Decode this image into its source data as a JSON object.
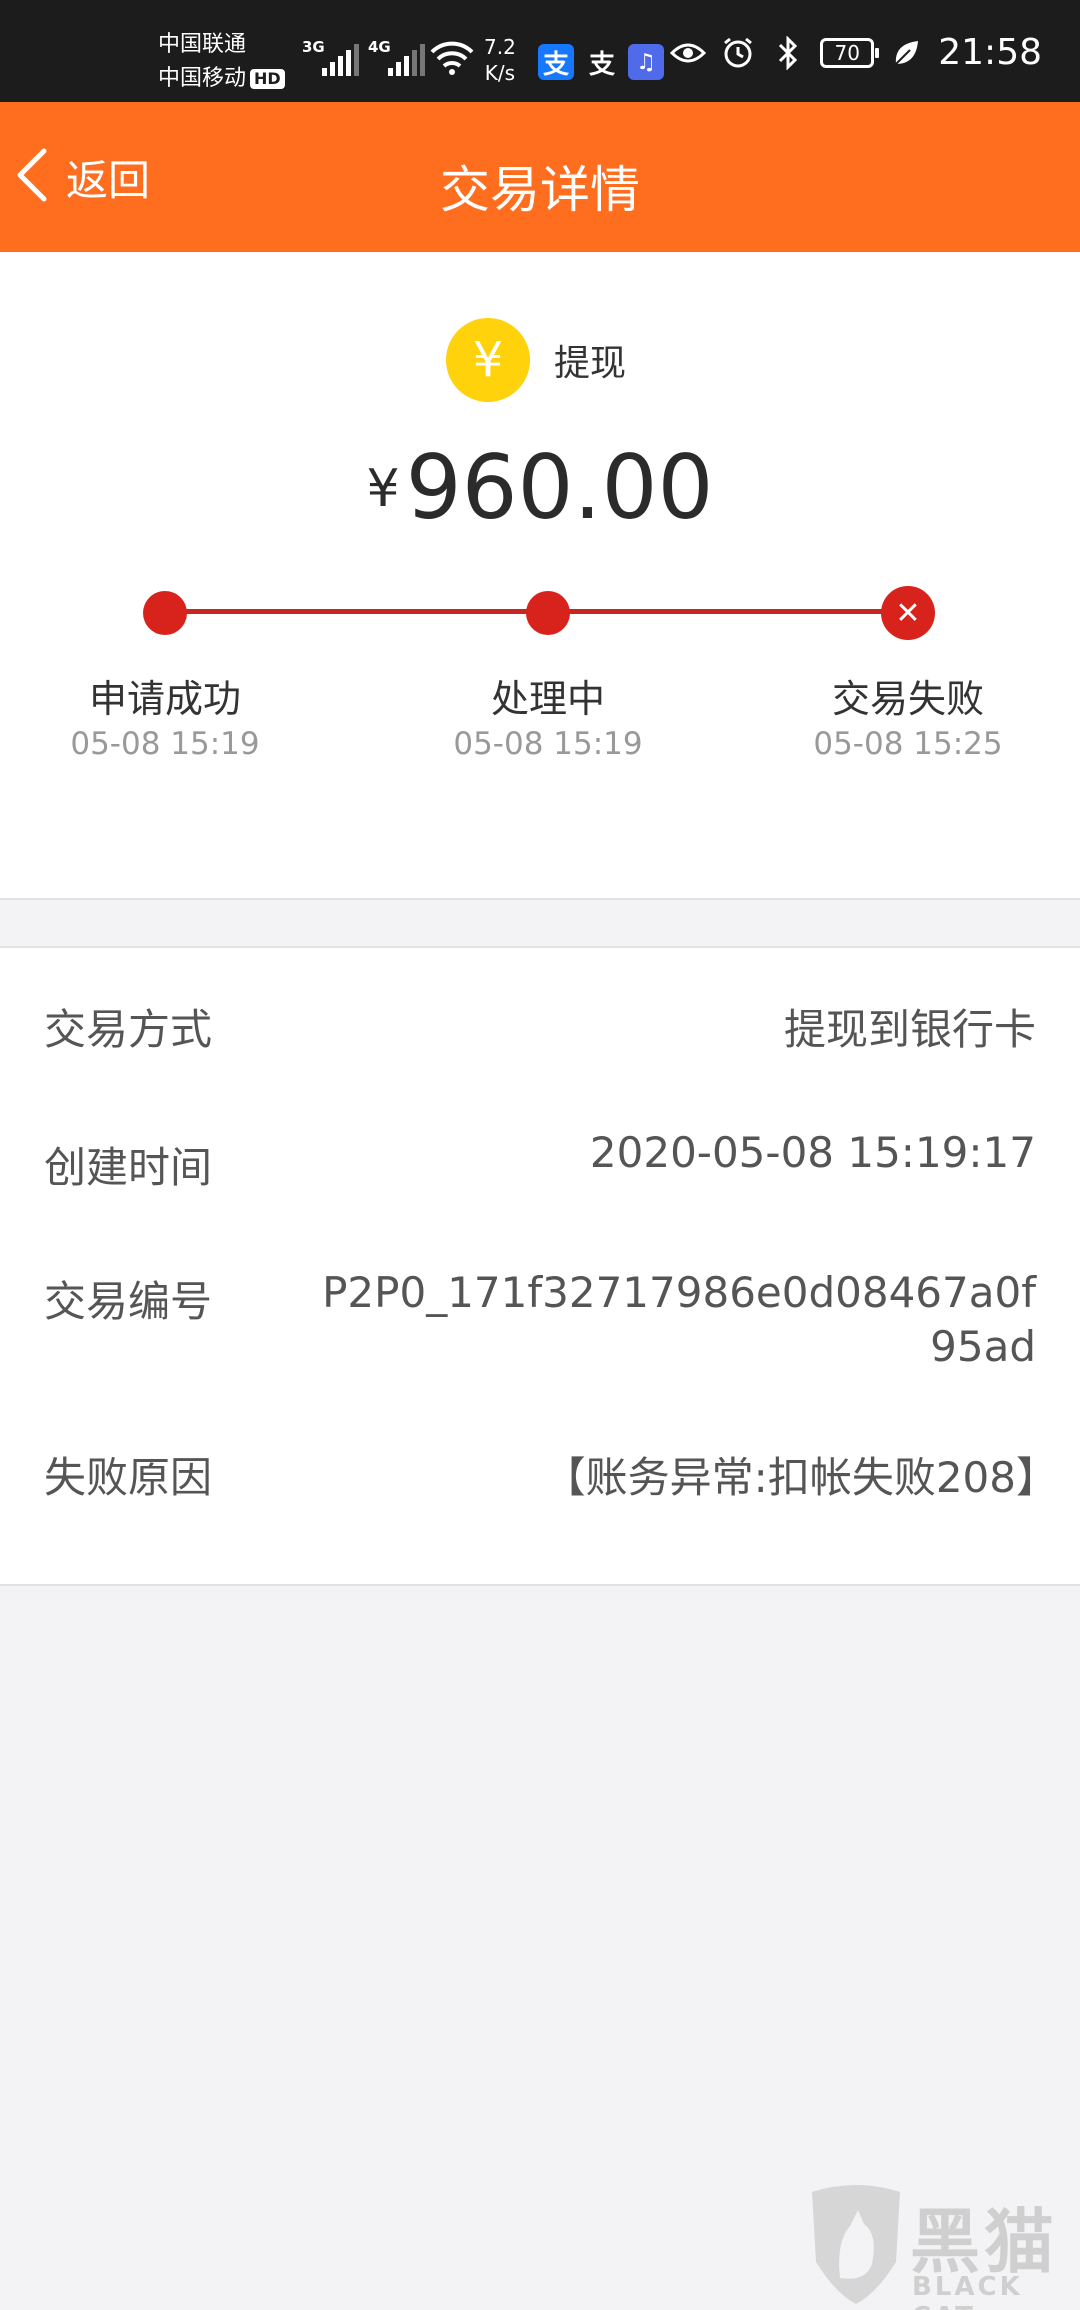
{
  "status_bar": {
    "carrier1": "中国联通",
    "carrier2": "中国移动",
    "hd_badge": "HD",
    "net1": "3G",
    "net2": "4G",
    "speed_value": "7.2",
    "speed_unit": "K/s",
    "battery": "70",
    "time": "21:58",
    "icons": [
      "alipay-icon",
      "alipay-outline-icon",
      "music-icon",
      "eye-icon",
      "alarm-icon",
      "bluetooth-icon",
      "battery-icon",
      "leaf-icon"
    ]
  },
  "nav": {
    "back_label": "返回",
    "title": "交易详情"
  },
  "summary": {
    "type_icon": "¥",
    "type_label": "提现",
    "currency": "¥",
    "amount": "960.00",
    "steps": [
      {
        "label": "申请成功",
        "time": "05-08 15:19",
        "state": "done"
      },
      {
        "label": "处理中",
        "time": "05-08 15:19",
        "state": "done"
      },
      {
        "label": "交易失败",
        "time": "05-08 15:25",
        "state": "failed"
      }
    ]
  },
  "details": [
    {
      "label": "交易方式",
      "value": "提现到银行卡"
    },
    {
      "label": "创建时间",
      "value": "2020-05-08 15:19:17"
    },
    {
      "label": "交易编号",
      "value": "P2P0_171f32717986e0d08467a0f95ad"
    },
    {
      "label": "失败原因",
      "value": "【账务异常:扣帐失败208】"
    }
  ],
  "watermark": {
    "cn": "黑猫",
    "en": "BLACK CAT"
  },
  "colors": {
    "nav_bg": "#ff6d1f",
    "progress_red": "#d7231b",
    "coin_yellow": "#ffd20c"
  }
}
